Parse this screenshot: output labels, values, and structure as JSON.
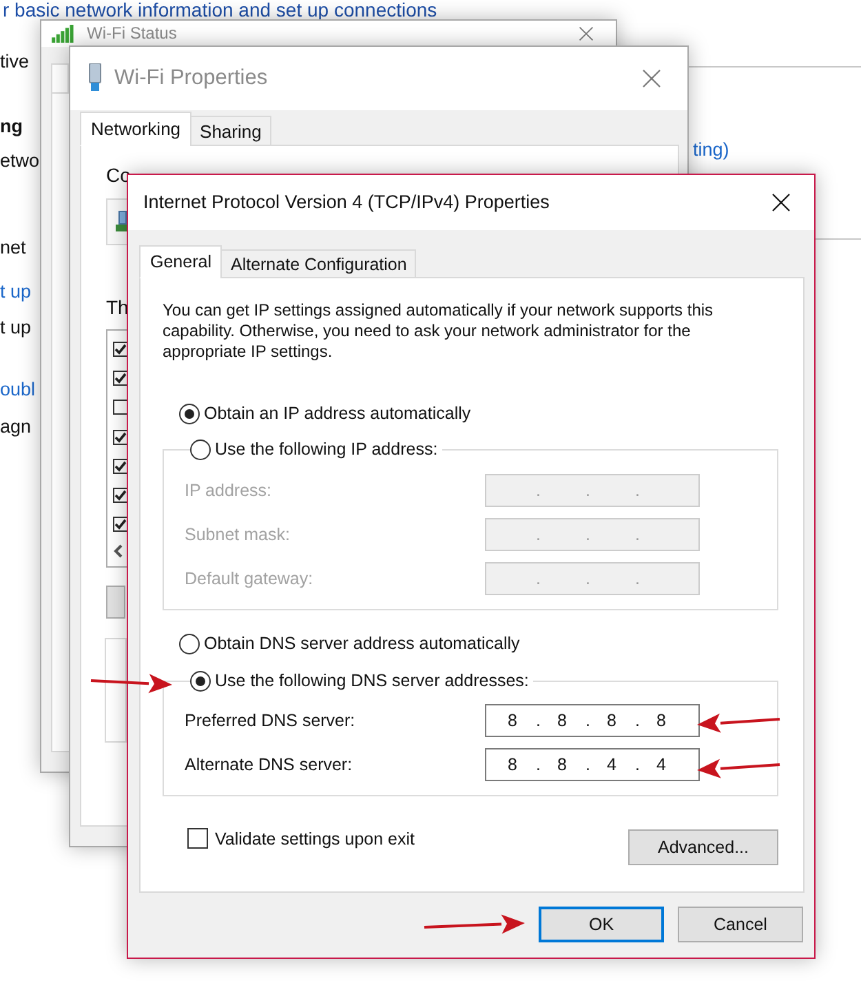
{
  "background_page": {
    "heading": "r basic network information and set up connections",
    "left_fragments": [
      {
        "text": "tive",
        "kind": "text"
      },
      {
        "text": "ng",
        "kind": "bold"
      },
      {
        "text": "etwo",
        "kind": "text"
      },
      {
        "text": "net",
        "kind": "text"
      },
      {
        "text": "t up",
        "kind": "link"
      },
      {
        "text": "t up",
        "kind": "text"
      },
      {
        "text": "oubl",
        "kind": "link"
      },
      {
        "text": "agn",
        "kind": "text"
      }
    ],
    "right_fragment": {
      "text": "ting)",
      "kind": "link"
    }
  },
  "wifi_status": {
    "title": "Wi-Fi Status"
  },
  "wifi_properties": {
    "title": "Wi-Fi Properties",
    "tabs": [
      {
        "label": "Networking",
        "selected": true
      },
      {
        "label": "Sharing",
        "selected": false
      }
    ],
    "connect_label": "Co",
    "items_label": "Th",
    "items": [
      {
        "checked": true
      },
      {
        "checked": true
      },
      {
        "checked": false
      },
      {
        "checked": true
      },
      {
        "checked": true
      },
      {
        "checked": true
      },
      {
        "checked": true
      }
    ]
  },
  "ipv4_dialog": {
    "title": "Internet Protocol Version 4 (TCP/IPv4) Properties",
    "tabs": [
      {
        "label": "General",
        "selected": true
      },
      {
        "label": "Alternate Configuration",
        "selected": false
      }
    ],
    "description": "You can get IP settings assigned automatically if your network supports this capability. Otherwise, you need to ask your network administrator for the appropriate IP settings.",
    "octet_separator": ".",
    "ip_options": [
      {
        "label": "Obtain an IP address automatically",
        "selected": true
      },
      {
        "label": "Use the following IP address:",
        "selected": false
      }
    ],
    "ip_fields": [
      {
        "label": "IP address:",
        "disabled": true
      },
      {
        "label": "Subnet mask:",
        "disabled": true
      },
      {
        "label": "Default gateway:",
        "disabled": true
      }
    ],
    "dns_options": [
      {
        "label": "Obtain DNS server address automatically",
        "selected": false
      },
      {
        "label": "Use the following DNS server addresses:",
        "selected": true
      }
    ],
    "dns_fields": [
      {
        "label": "Preferred DNS server:",
        "disabled": false,
        "octets": [
          "8",
          "8",
          "8",
          "8"
        ]
      },
      {
        "label": "Alternate DNS server:",
        "disabled": false,
        "octets": [
          "8",
          "8",
          "4",
          "4"
        ]
      }
    ],
    "validate": {
      "label": "Validate settings upon exit",
      "checked": false
    },
    "advanced_button": "Advanced...",
    "buttons": [
      {
        "label": "OK",
        "default": true
      },
      {
        "label": "Cancel",
        "default": false
      }
    ]
  }
}
